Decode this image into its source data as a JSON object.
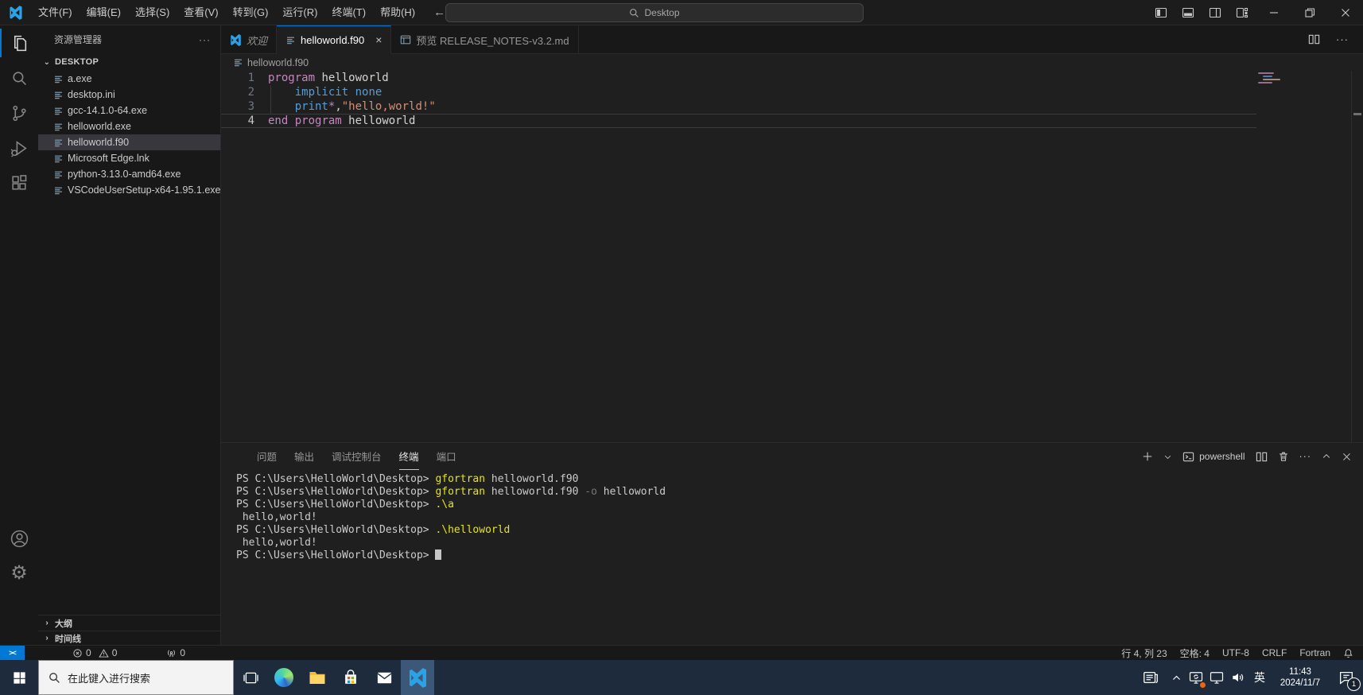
{
  "titlebar": {
    "menus": [
      "文件(F)",
      "编辑(E)",
      "选择(S)",
      "查看(V)",
      "转到(G)",
      "运行(R)",
      "终端(T)",
      "帮助(H)"
    ],
    "search_placeholder": "Desktop"
  },
  "explorer": {
    "title": "资源管理器",
    "root": "DESKTOP",
    "files": [
      "a.exe",
      "desktop.ini",
      "gcc-14.1.0-64.exe",
      "helloworld.exe",
      "helloworld.f90",
      "Microsoft Edge.lnk",
      "python-3.13.0-amd64.exe",
      "VSCodeUserSetup-x64-1.95.1.exe"
    ],
    "selected_index": 4,
    "sections": {
      "outline": "大纲",
      "timeline": "时间线"
    }
  },
  "editor": {
    "tabs": [
      {
        "label": "欢迎",
        "icon": "vscode",
        "italic": true,
        "active": false
      },
      {
        "label": "helloworld.f90",
        "icon": "file",
        "italic": false,
        "active": true,
        "closable": true
      },
      {
        "label": "预览 RELEASE_NOTES-v3.2.md",
        "icon": "preview",
        "italic": false,
        "active": false
      }
    ],
    "breadcrumb": "helloworld.f90",
    "active_line": 4,
    "palette": {
      "keyword": "#c586c0",
      "builtin": "#569cd6",
      "string": "#ce9178",
      "plain": "#d4d4d4"
    },
    "code_lines": [
      {
        "num": "1",
        "tokens": [
          {
            "t": "program",
            "c": "keyword"
          },
          {
            "t": " helloworld"
          }
        ]
      },
      {
        "num": "2",
        "tokens": [
          {
            "t": "    "
          },
          {
            "t": "implicit",
            "c": "builtin"
          },
          {
            "t": " "
          },
          {
            "t": "none",
            "c": "builtin"
          }
        ]
      },
      {
        "num": "3",
        "tokens": [
          {
            "t": "    "
          },
          {
            "t": "print",
            "c": "builtin"
          },
          {
            "t": "*",
            "c": "keyword"
          },
          {
            "t": ","
          },
          {
            "t": "\"hello,world!\"",
            "c": "string"
          }
        ]
      },
      {
        "num": "4",
        "tokens": [
          {
            "t": "end",
            "c": "keyword"
          },
          {
            "t": " "
          },
          {
            "t": "program",
            "c": "keyword"
          },
          {
            "t": " helloworld"
          }
        ]
      }
    ]
  },
  "panel": {
    "tabs": [
      "问题",
      "输出",
      "调试控制台",
      "终端",
      "端口"
    ],
    "active_tab_index": 3,
    "terminal_name": "powershell",
    "terminal": {
      "palette": {
        "text": "#cccccc",
        "command": "#e5e510",
        "dim": "#767676"
      },
      "cursor_line_index": 6,
      "lines": [
        [
          {
            "t": "PS C:\\Users\\HelloWorld\\Desktop> "
          },
          {
            "t": "gfortran",
            "c": "command"
          },
          {
            "t": " helloworld.f90"
          }
        ],
        [
          {
            "t": "PS C:\\Users\\HelloWorld\\Desktop> "
          },
          {
            "t": "gfortran",
            "c": "command"
          },
          {
            "t": " helloworld.f90"
          },
          {
            "t": " -o",
            "c": "dim"
          },
          {
            "t": " helloworld"
          }
        ],
        [
          {
            "t": "PS C:\\Users\\HelloWorld\\Desktop> "
          },
          {
            "t": ".\\a",
            "c": "command"
          }
        ],
        [
          {
            "t": " hello,world!"
          }
        ],
        [
          {
            "t": "PS C:\\Users\\HelloWorld\\Desktop> "
          },
          {
            "t": ".\\helloworld",
            "c": "command"
          }
        ],
        [
          {
            "t": " hello,world!"
          }
        ],
        [
          {
            "t": "PS C:\\Users\\HelloWorld\\Desktop> "
          }
        ]
      ]
    }
  },
  "statusbar": {
    "errors": "0",
    "warnings": "0",
    "ports": "0",
    "cursor": "行 4, 列 23",
    "indent": "空格: 4",
    "encoding": "UTF-8",
    "eol": "CRLF",
    "language": "Fortran"
  },
  "taskbar": {
    "search_placeholder": "在此键入进行搜索",
    "ime": "英",
    "time": "11:43",
    "date": "2024/11/7",
    "notification_badge": "1"
  },
  "colors": {
    "accent_blue": "#0078d4",
    "selection_bg": "#37373d",
    "taskbar_bg": "#1d2b3c",
    "terminal_command": "#e5e510"
  }
}
